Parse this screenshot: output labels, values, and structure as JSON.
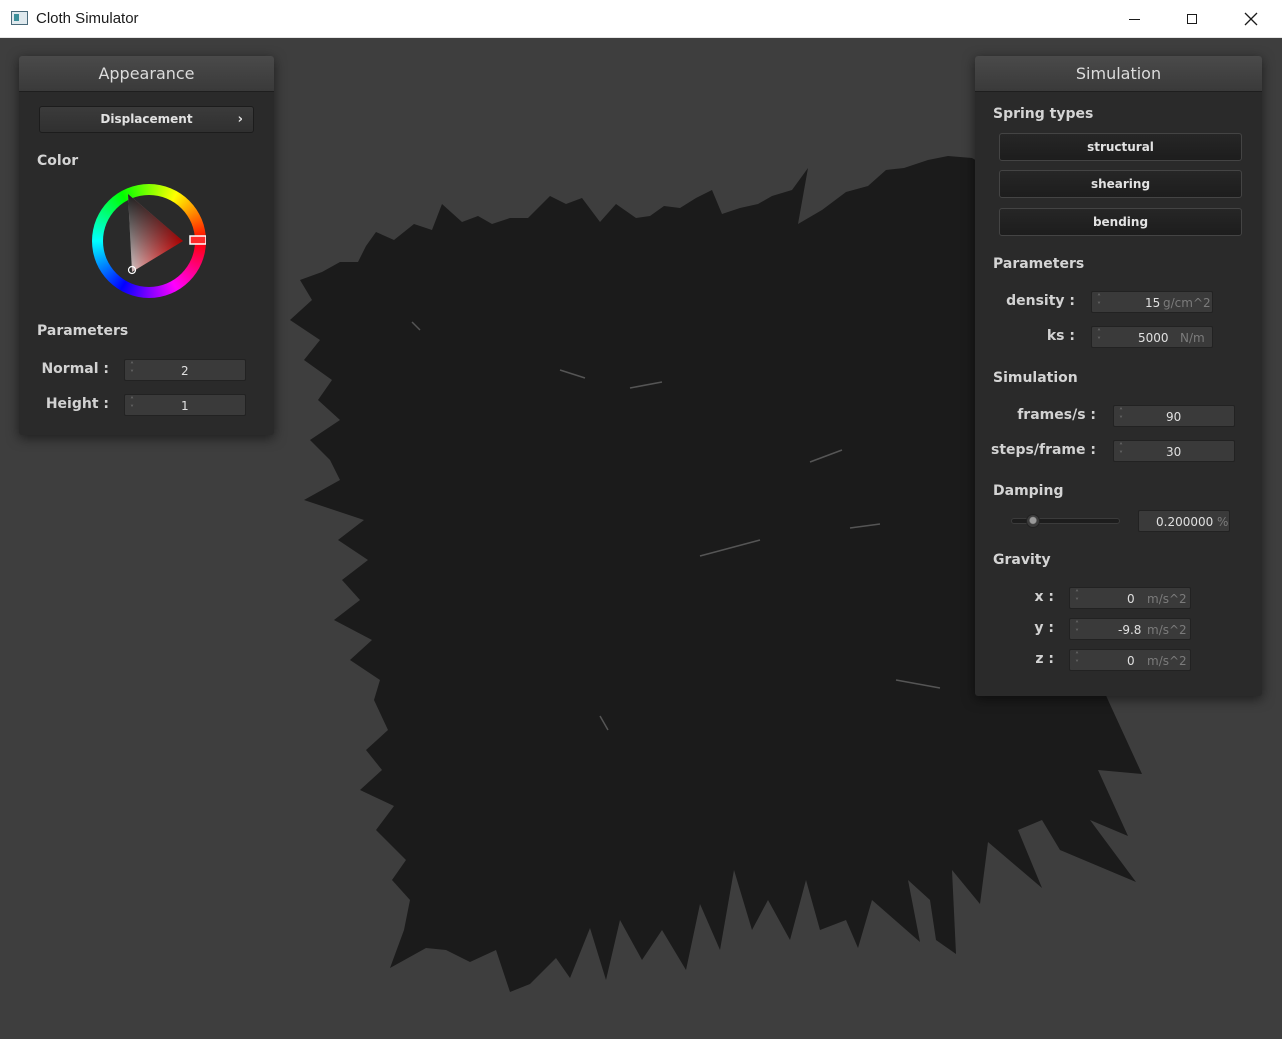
{
  "window": {
    "title": "Cloth Simulator"
  },
  "appearance": {
    "title": "Appearance",
    "shader_select": "Displacement",
    "shader_arrow": "›",
    "color_label": "Color",
    "color_value": "#ff0000",
    "parameters_label": "Parameters",
    "normal_label": "Normal :",
    "normal_value": "2",
    "height_label": "Height :",
    "height_value": "1"
  },
  "simulation": {
    "title": "Simulation",
    "spring_types_label": "Spring types",
    "spring_structural": "structural",
    "spring_shearing": "shearing",
    "spring_bending": "bending",
    "parameters_label": "Parameters",
    "density_label": "density :",
    "density_value": "15",
    "density_unit": "g/cm^2",
    "ks_label": "ks :",
    "ks_value": "5000",
    "ks_unit": "N/m",
    "simulation_label": "Simulation",
    "fps_label": "frames/s :",
    "fps_value": "90",
    "steps_label": "steps/frame :",
    "steps_value": "30",
    "damping_label": "Damping",
    "damping_value": "0.200000",
    "damping_unit": "%",
    "damping_fraction": 0.2,
    "gravity_label": "Gravity",
    "gx_label": "x :",
    "gx_value": "0",
    "gy_label": "y :",
    "gy_value": "-9.8",
    "gz_label": "z :",
    "gz_value": "0",
    "gravity_unit": "m/s^2"
  },
  "colors": {
    "background": "#3e3e3e",
    "panel": "#2a2a2a",
    "cloth": "#1b1b1b"
  }
}
